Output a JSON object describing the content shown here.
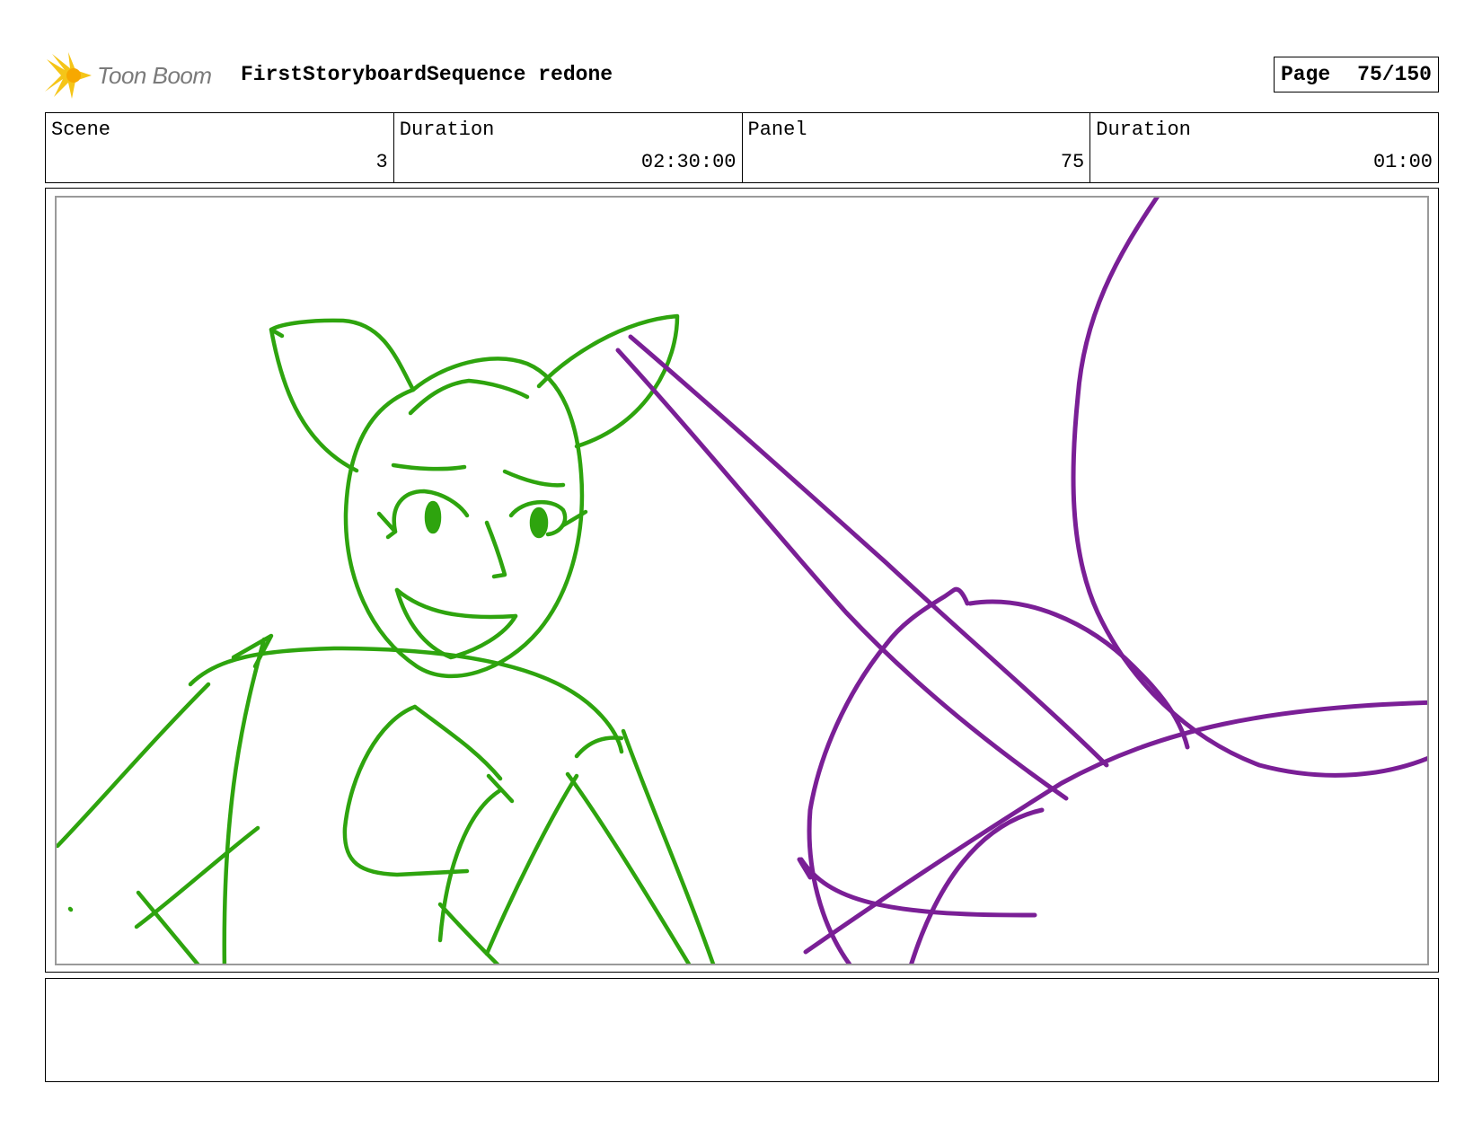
{
  "header": {
    "logo_text": "Toon Boom",
    "title": "FirstStoryboardSequence redone",
    "page_label": "Page",
    "page_value": "75/150"
  },
  "info": {
    "scene_label": "Scene",
    "scene_value": "3",
    "scene_duration_label": "Duration",
    "scene_duration_value": "02:30:00",
    "panel_label": "Panel",
    "panel_value": "75",
    "panel_duration_label": "Duration",
    "panel_duration_value": "01:00"
  },
  "colors": {
    "green_sketch": "#2ea40e",
    "purple_sketch": "#7a1f96",
    "logo_yellow": "#f5c518",
    "logo_text": "#7a7a7a"
  },
  "notes": {
    "text": ""
  }
}
